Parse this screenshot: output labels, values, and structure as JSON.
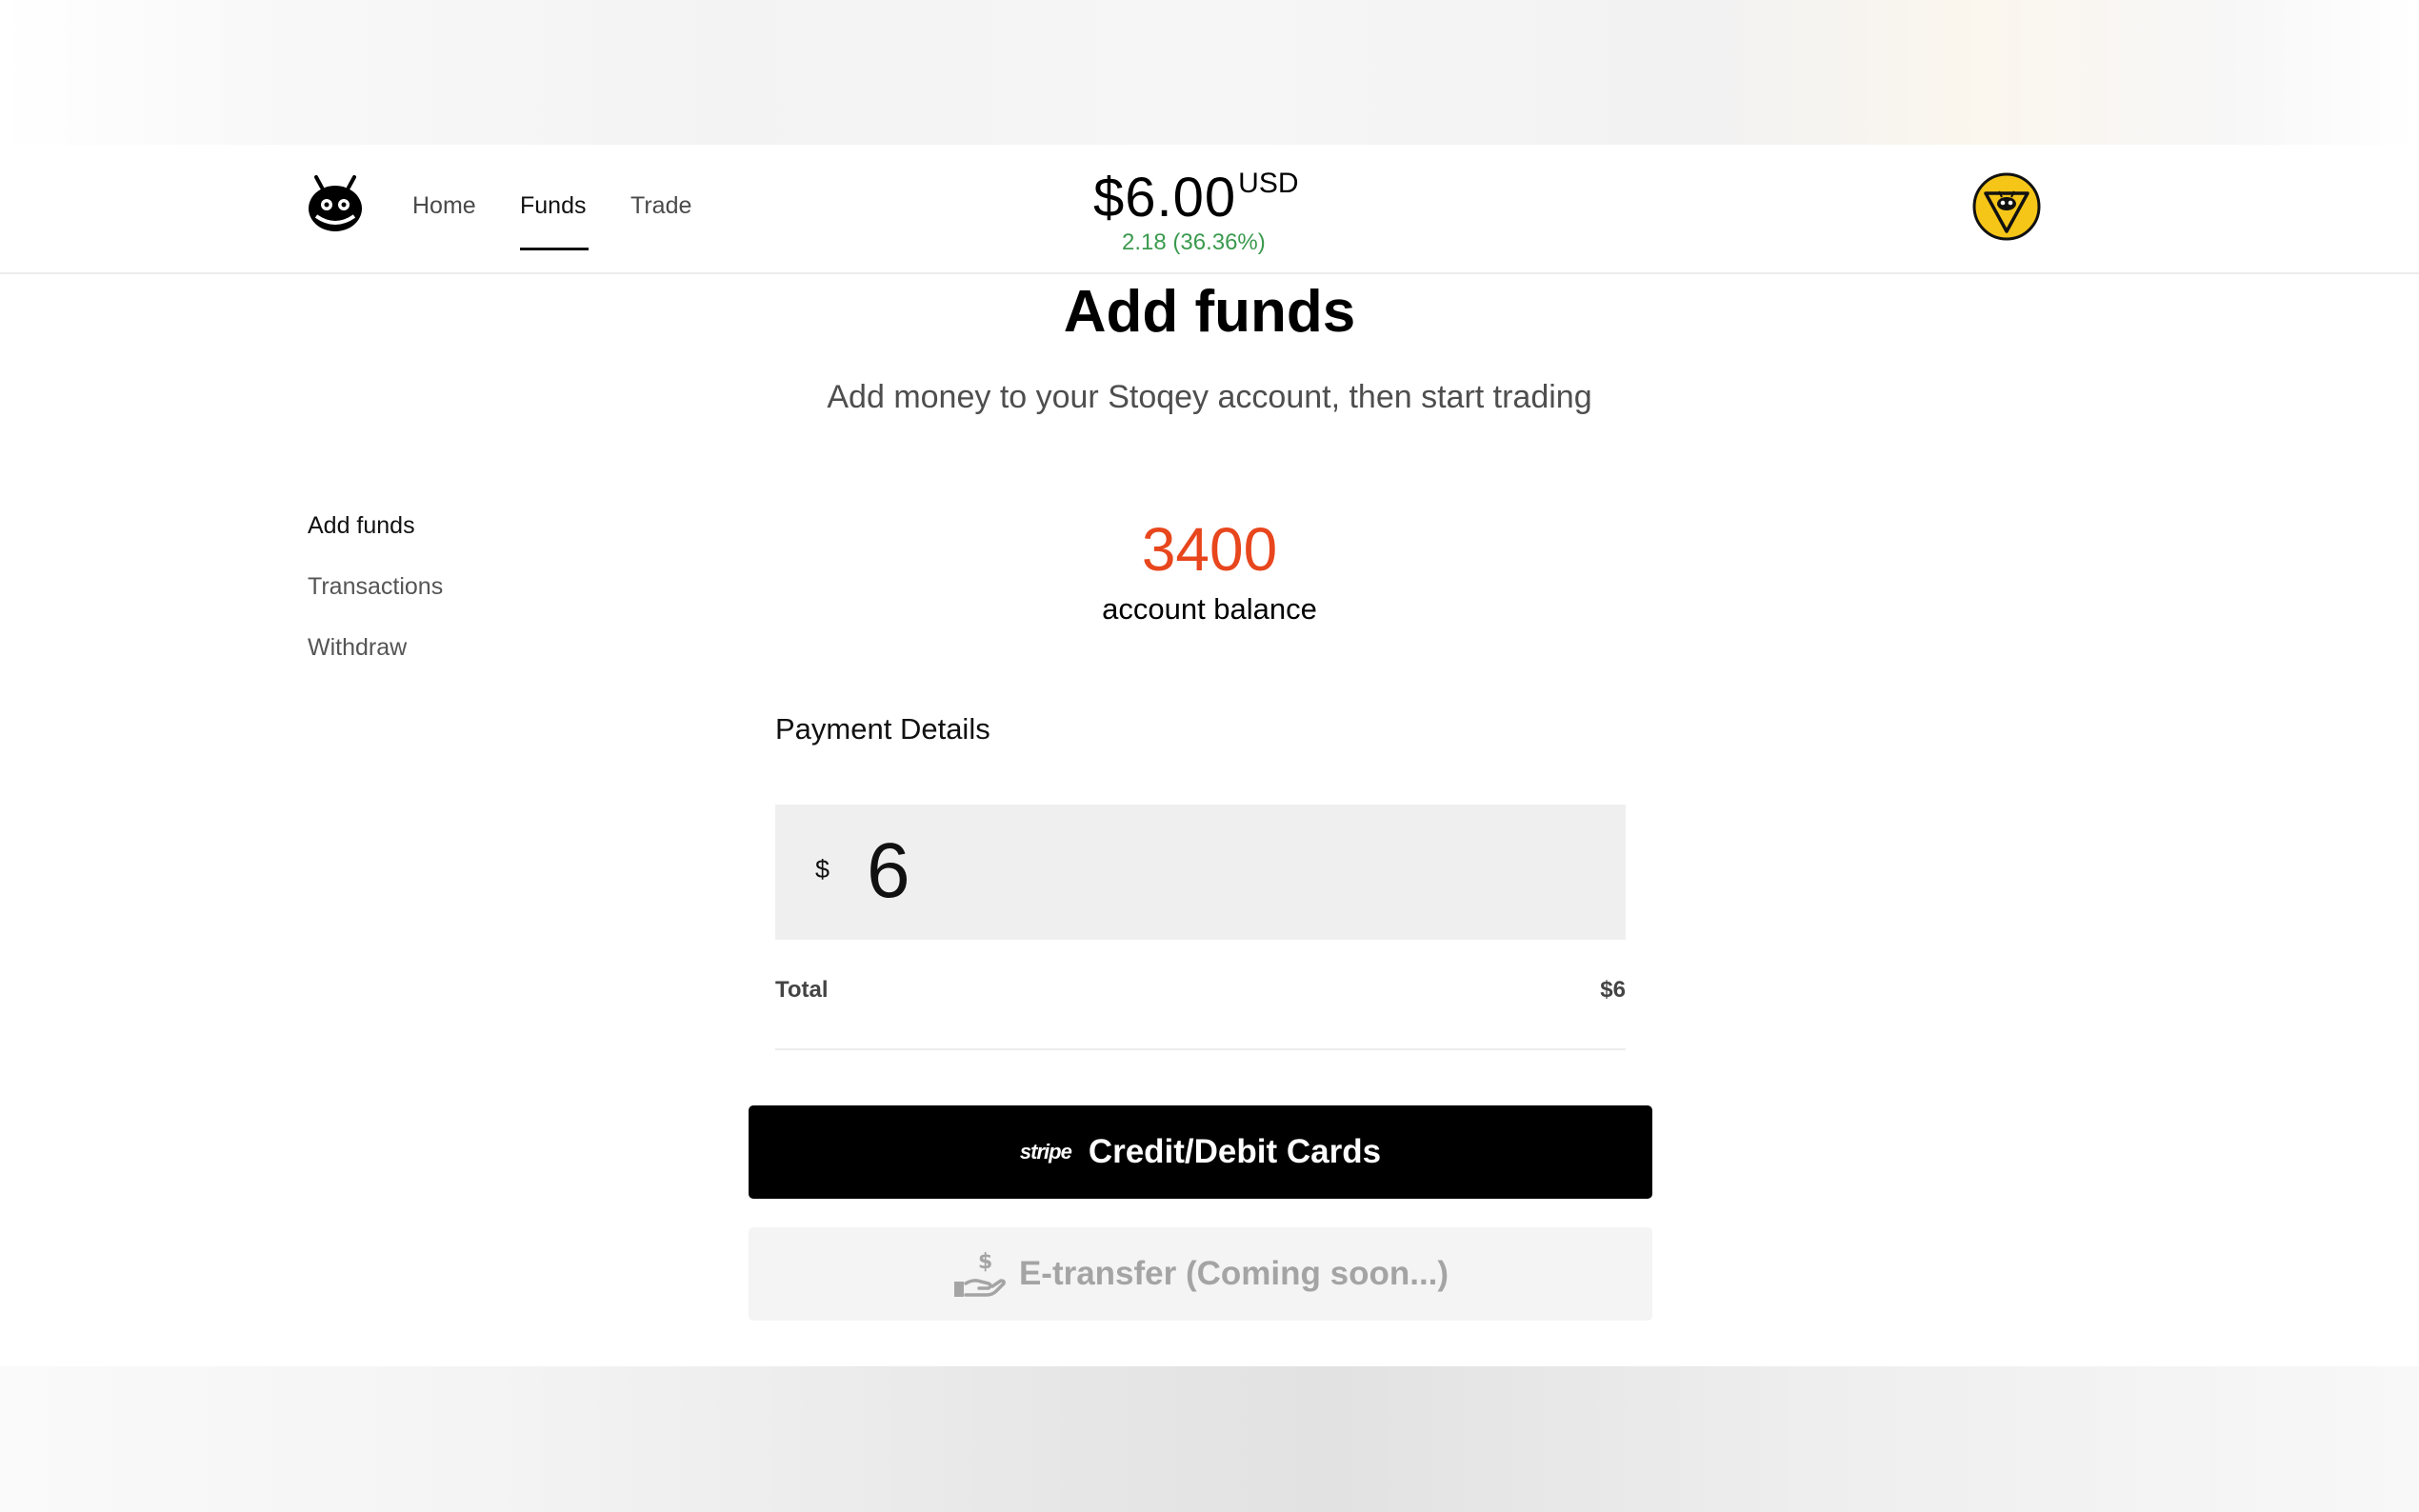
{
  "nav": {
    "home": "Home",
    "funds": "Funds",
    "trade": "Trade"
  },
  "header": {
    "price": "$6.00",
    "currency": "USD",
    "change": "2.18 (36.36%)"
  },
  "page": {
    "title": "Add funds",
    "subtitle": "Add money to your Stoqey account, then start trading"
  },
  "sidebar": {
    "items": [
      {
        "label": "Add funds"
      },
      {
        "label": "Transactions"
      },
      {
        "label": "Withdraw"
      }
    ]
  },
  "balance": {
    "value": "3400",
    "label": "account balance"
  },
  "payment": {
    "title": "Payment Details",
    "currency_symbol": "$",
    "amount": "6",
    "total_label": "Total",
    "total_value": "$6"
  },
  "buttons": {
    "card_provider": "stripe",
    "card_label": "Credit/Debit Cards",
    "etransfer_label": "E-transfer (Coming soon...)"
  },
  "icons": {
    "logo": "robot-logo-icon",
    "avatar": "user-avatar-icon",
    "etransfer": "hand-money-icon"
  },
  "colors": {
    "balance": "#e8461d",
    "change_positive": "#3b9a4e",
    "primary_button": "#000000",
    "avatar_yellow": "#f5c518"
  }
}
